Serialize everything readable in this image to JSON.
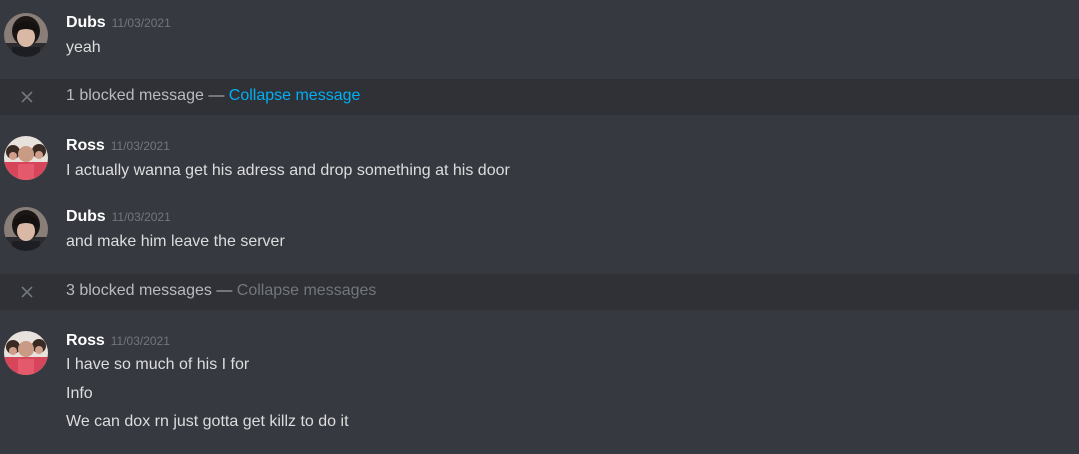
{
  "messages": [
    {
      "author": "Dubs",
      "timestamp": "11/03/2021",
      "avatar_icon": "dark-hair-person-avatar",
      "lines": [
        "yeah"
      ]
    },
    {
      "author": "Ross",
      "timestamp": "11/03/2021",
      "avatar_icon": "group-photo-avatar",
      "lines": [
        "I actually wanna get his adress and drop something at his door"
      ]
    },
    {
      "author": "Dubs",
      "timestamp": "11/03/2021",
      "avatar_icon": "dark-hair-person-avatar",
      "lines": [
        "and make him leave the server"
      ]
    },
    {
      "author": "Ross",
      "timestamp": "11/03/2021",
      "avatar_icon": "group-photo-avatar",
      "lines": [
        "I have so much of his I for",
        "Info",
        "We can dox rn just gotta get killz to do it"
      ]
    }
  ],
  "blocked": [
    {
      "count_text": "1 blocked message",
      "separator": "—",
      "action_label": "Collapse message",
      "action_color": "#00aff4",
      "icon": "close-icon"
    },
    {
      "count_text": "3 blocked messages",
      "separator": "—",
      "action_label": "Collapse messages",
      "action_color": "#72767d",
      "icon": "close-icon"
    }
  ],
  "colors": {
    "background": "#36393f",
    "blocked_row_background": "#2f3136",
    "username": "#ffffff",
    "timestamp": "#72767d",
    "text": "#dcddde"
  }
}
